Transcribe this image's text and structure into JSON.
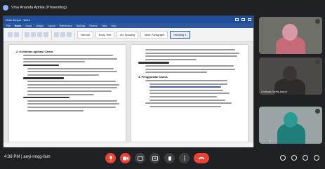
{
  "meeting": {
    "presenter_label": "Vina Ananda Aprilia (Presenting)",
    "time": "4:38 PM",
    "separator": "|",
    "meeting_code": "aeyi-nnqg-fam"
  },
  "word": {
    "window_title": "Draft Skripsi - Word",
    "tabs": [
      "File",
      "Home",
      "Insert",
      "Design",
      "Layout",
      "References",
      "Mailings",
      "Review",
      "View",
      "Help"
    ],
    "active_tab": "Home",
    "styles": [
      "Normal",
      "Body Text",
      "No Spacing",
      "Table Paragraph",
      "Heading 1"
    ],
    "selected_style": "Heading 1",
    "left_heading": "2. Kelebihan aplikasi Canva",
    "right_heading": "4. Penggunaan Canva"
  },
  "participants": [
    {
      "name": ""
    },
    {
      "name": "Annisaa Ariefa Astuti"
    },
    {
      "name": "Nur Fitriani"
    }
  ],
  "icons": {
    "mic": "mic-icon",
    "camera": "camera-icon",
    "captions": "captions-icon",
    "present": "present-icon",
    "raise_hand": "hand-icon",
    "more": "more-icon",
    "end_call": "end-call-icon"
  },
  "colors": {
    "word_blue": "#2b579a",
    "end_call_red": "#ea4335",
    "meet_bg": "#202124"
  }
}
